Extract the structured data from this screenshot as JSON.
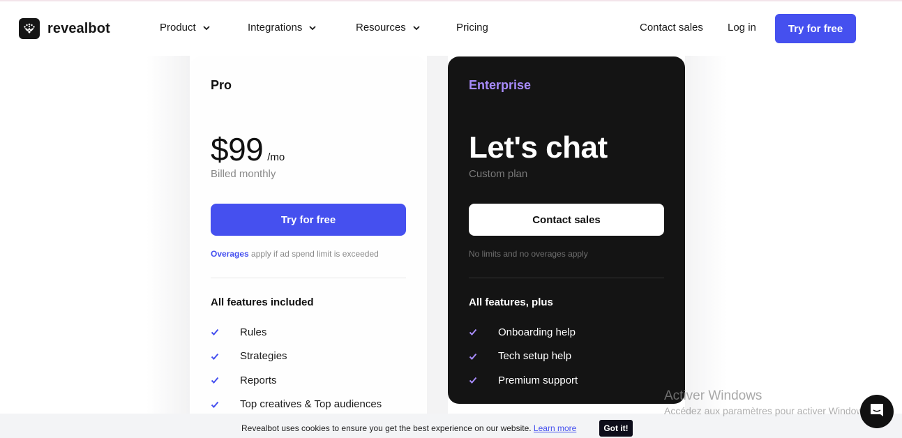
{
  "brand": {
    "name": "revealbot",
    "logo_icon": "revealbot-logo-icon"
  },
  "nav": {
    "items": [
      {
        "label": "Product",
        "has_dropdown": true
      },
      {
        "label": "Integrations",
        "has_dropdown": true
      },
      {
        "label": "Resources",
        "has_dropdown": true
      },
      {
        "label": "Pricing",
        "has_dropdown": false
      }
    ],
    "contact_sales": "Contact sales",
    "log_in": "Log in",
    "try_free": "Try for free"
  },
  "colors": {
    "accent": "#4550ef",
    "enterprise_accent": "#a78bfa",
    "dark_card": "#141414"
  },
  "plans": {
    "pro": {
      "name": "Pro",
      "price": "$99",
      "price_unit": "/mo",
      "billing": "Billed monthly",
      "cta": "Try for free",
      "note_link": "Overages",
      "note_text": " apply if ad spend limit is exceeded",
      "features_title": "All features included",
      "features": [
        "Rules",
        "Strategies",
        "Reports",
        "Top creatives & Top audiences"
      ]
    },
    "enterprise": {
      "name": "Enterprise",
      "price": "Let's chat",
      "billing": "Custom plan",
      "cta": "Contact sales",
      "note_text": "No limits and no overages apply",
      "features_title": "All features, plus",
      "features": [
        "Onboarding help",
        "Tech setup help",
        "Premium support"
      ]
    }
  },
  "cookie": {
    "text": "Revealbot uses cookies to ensure you get the best experience on our website. ",
    "link": "Learn more",
    "button": "Got it!"
  },
  "watermark": {
    "title": "Activer Windows",
    "subtitle": "Accédez aux paramètres pour activer Windows."
  },
  "chat_widget": {
    "icon": "chat-bubble-icon"
  }
}
